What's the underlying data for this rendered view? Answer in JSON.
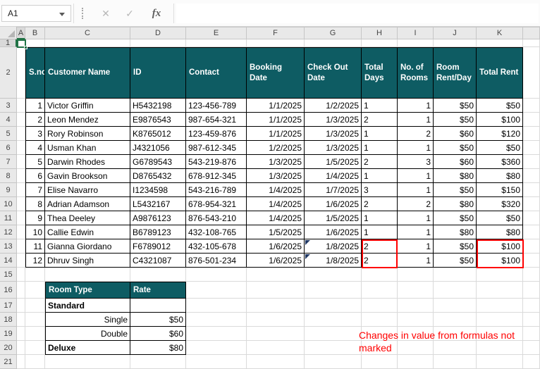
{
  "formula_bar": {
    "name_box_value": "A1",
    "cancel_icon": "✕",
    "enter_icon": "✓",
    "fx_label": "fx"
  },
  "grid": {
    "columns": [
      "A",
      "B",
      "C",
      "D",
      "E",
      "F",
      "G",
      "H",
      "I",
      "J",
      "K"
    ],
    "row_numbers": [
      "1",
      "2",
      "3",
      "4",
      "5",
      "6",
      "7",
      "8",
      "9",
      "10",
      "11",
      "12",
      "13",
      "14",
      "15",
      "16",
      "17",
      "18",
      "19",
      "20",
      "21"
    ],
    "selected_cell": "A1"
  },
  "table": {
    "headers": [
      "S.no",
      "Customer Name",
      "ID",
      "Contact",
      "Booking Date",
      "Check Out Date",
      "Total Days",
      "No. of Rooms",
      "Room Rent/Day",
      "Total Rent"
    ],
    "rows": [
      [
        "1",
        "Victor Griffin",
        "H5432198",
        "123-456-789",
        "1/1/2025",
        "1/2/2025",
        "1",
        "1",
        "$50",
        "$50"
      ],
      [
        "2",
        "Leon Mendez",
        "E9876543",
        "987-654-321",
        "1/1/2025",
        "1/3/2025",
        "2",
        "1",
        "$50",
        "$100"
      ],
      [
        "3",
        "Rory Robinson",
        "K8765012",
        "123-459-876",
        "1/1/2025",
        "1/3/2025",
        "1",
        "2",
        "$60",
        "$120"
      ],
      [
        "4",
        "Usman Khan",
        "J4321056",
        "987-612-345",
        "1/2/2025",
        "1/3/2025",
        "1",
        "1",
        "$50",
        "$50"
      ],
      [
        "5",
        "Darwin Rhodes",
        "G6789543",
        "543-219-876",
        "1/3/2025",
        "1/5/2025",
        "2",
        "3",
        "$60",
        "$360"
      ],
      [
        "6",
        "Gavin Brookson",
        "D8765432",
        "678-912-345",
        "1/3/2025",
        "1/4/2025",
        "1",
        "1",
        "$80",
        "$80"
      ],
      [
        "7",
        "Elise Navarro",
        "I1234598",
        "543-216-789",
        "1/4/2025",
        "1/7/2025",
        "3",
        "1",
        "$50",
        "$150"
      ],
      [
        "8",
        "Adrian Adamson",
        "L5432167",
        "678-954-321",
        "1/4/2025",
        "1/6/2025",
        "2",
        "2",
        "$80",
        "$320"
      ],
      [
        "9",
        "Thea Deeley",
        "A9876123",
        "876-543-210",
        "1/4/2025",
        "1/5/2025",
        "1",
        "1",
        "$50",
        "$50"
      ],
      [
        "10",
        "Callie Edwin",
        "B6789123",
        "432-108-765",
        "1/5/2025",
        "1/6/2025",
        "1",
        "1",
        "$80",
        "$80"
      ],
      [
        "11",
        "Gianna Giordano",
        "F6789012",
        "432-105-678",
        "1/6/2025",
        "1/8/2025",
        "2",
        "1",
        "$50",
        "$100"
      ],
      [
        "12",
        "Dhruv Singh",
        "C4321087",
        "876-501-234",
        "1/6/2025",
        "1/8/2025",
        "2",
        "1",
        "$50",
        "$100"
      ]
    ]
  },
  "rate_table": {
    "headers": [
      "Room Type",
      "Rate"
    ],
    "rows": [
      [
        "Standard",
        ""
      ],
      [
        "Single",
        "$50"
      ],
      [
        "Double",
        "$60"
      ],
      [
        "Deluxe",
        "$80"
      ]
    ]
  },
  "annotation": {
    "text": "Changes in value from formulas not marked"
  },
  "colors": {
    "table_header_bg": "#0e5c63",
    "highlight_red": "#ff0000",
    "annotation_red": "#ff0000",
    "selection_green": "#217346"
  }
}
